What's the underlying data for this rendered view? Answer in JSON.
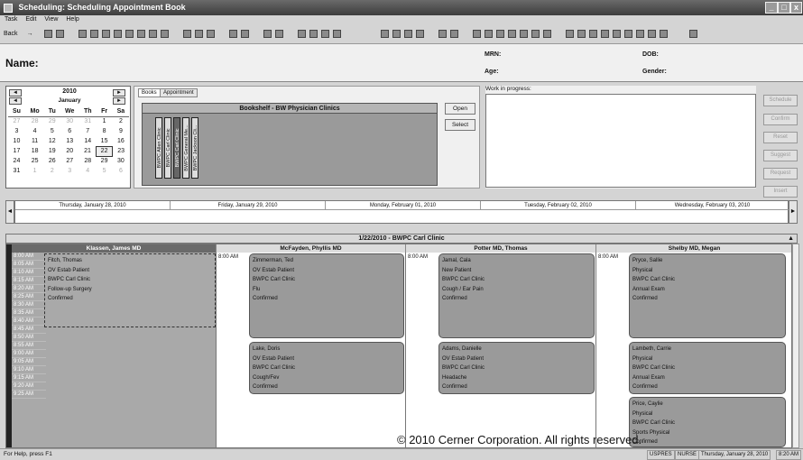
{
  "window": {
    "title": "Scheduling: Scheduling Appointment Book",
    "min": "_",
    "max": "□",
    "close": "x"
  },
  "menu": [
    "Task",
    "Edit",
    "View",
    "Help"
  ],
  "toolbar": {
    "back": "Back",
    "forward": "→"
  },
  "demographics": {
    "name_label": "Name:",
    "mrn_label": "MRN:",
    "age_label": "Age:",
    "dob_label": "DOB:",
    "gender_label": "Gender:"
  },
  "calendar": {
    "year": "2010",
    "month": "January",
    "days": [
      "Su",
      "Mo",
      "Tu",
      "We",
      "Th",
      "Fr",
      "Sa"
    ],
    "weeks": [
      [
        "27",
        "28",
        "29",
        "30",
        "31",
        "1",
        "2"
      ],
      [
        "3",
        "4",
        "5",
        "6",
        "7",
        "8",
        "9"
      ],
      [
        "10",
        "11",
        "12",
        "13",
        "14",
        "15",
        "16"
      ],
      [
        "17",
        "18",
        "19",
        "20",
        "21",
        "22",
        "23"
      ],
      [
        "24",
        "25",
        "26",
        "27",
        "28",
        "29",
        "30"
      ],
      [
        "31",
        "1",
        "2",
        "3",
        "4",
        "5",
        "6"
      ]
    ],
    "today": "22"
  },
  "books": {
    "tab_books": "Books",
    "tab_appointment": "Appointment",
    "shelf_title": "Bookshelf - BW Physician Clinics",
    "items": [
      "BWPC Allen Clinic",
      "BWPC Carl Clinic",
      "BWPC Carl Clinic",
      "BWPC General Me...",
      "BWPC Jackson Cli..."
    ],
    "open": "Open",
    "select": "Select"
  },
  "work": {
    "label": "Work in progress:"
  },
  "side_buttons": [
    "Schedule",
    "Confirm",
    "Reset",
    "Suggest",
    "Request",
    "Insert"
  ],
  "day_strip": [
    "Thursday, January 28, 2010",
    "Friday, January 29, 2010",
    "Monday, February 01, 2010",
    "Tuesday, February 02, 2010",
    "Wednesday, February 03, 2010"
  ],
  "schedule": {
    "title": "1/22/2010 - BWPC Carl Clinic",
    "columns": [
      "Klassen, James MD",
      "McFayden, Phyllis MD",
      "Potter MD, Thomas",
      "Shelby MD, Megan"
    ],
    "times": [
      "8:00 AM",
      "8:05 AM",
      "8:10 AM",
      "8:15 AM",
      "8:20 AM",
      "8:25 AM",
      "8:30 AM",
      "8:35 AM",
      "8:40 AM",
      "8:45 AM",
      "8:50 AM",
      "8:55 AM",
      "9:00 AM",
      "9:05 AM",
      "9:10 AM",
      "9:15 AM",
      "9:20 AM",
      "9:25 AM"
    ],
    "start_label": "8:00 AM",
    "col1_appt": [
      "Fitch, Thomas",
      "OV Estab Patient",
      "BWPC Carl Clinic",
      "Follow-up Surgery",
      "Confirmed"
    ],
    "col2_appts": [
      [
        "Zimmerman, Ted",
        "OV Estab Patient",
        "BWPC Carl Clinic",
        "Flu",
        "Confirmed"
      ],
      [
        "Lake, Doris",
        "OV Estab Patient",
        "BWPC Carl Clinic",
        "Cough/Fev",
        "Confirmed"
      ]
    ],
    "col3_appts": [
      [
        "Jamal, Cala",
        "New Patient",
        "BWPC Carl Clinic",
        "Cough / Ear Pain",
        "Confirmed"
      ],
      [
        "Adams, Danielle",
        "OV Estab Patient",
        "BWPC Carl Clinic",
        "Headache",
        "Confirmed"
      ]
    ],
    "col4_appts": [
      [
        "Pryce, Sallie",
        "Physical",
        "BWPC Carl Clinic",
        "Annual Exam",
        "Confirmed"
      ],
      [
        "Lambeth, Carrie",
        "Physical",
        "BWPC Carl Clinic",
        "Annual Exam",
        "Confirmed"
      ],
      [
        "Price, Caylie",
        "Physical",
        "BWPC Carl Clinic",
        "Sports Physical",
        "Confirmed"
      ]
    ]
  },
  "status": {
    "help": "For Help, press F1",
    "user": "USPRES",
    "role": "NURSE",
    "date": "Thursday, January 28, 2010",
    "time": "8:20 AM"
  },
  "copyright": "© 2010 Cerner Corporation. All rights reserved."
}
